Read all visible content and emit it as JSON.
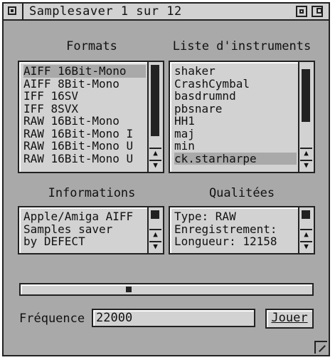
{
  "window": {
    "title": "Samplesaver 1 sur 12"
  },
  "formats": {
    "label": "Formats",
    "items": [
      "AIFF 16Bit-Mono",
      "AIFF 8Bit-Mono",
      "IFF 16SV",
      "IFF 8SVX",
      "RAW 16Bit-Mono",
      "RAW 16Bit-Mono I",
      "RAW 16Bit-Mono U",
      "RAW 16Bit-Mono U"
    ],
    "selected_index": 0
  },
  "instruments": {
    "label": "Liste d'instruments",
    "items": [
      "shaker",
      "CrashCymbal",
      "basdrumnd",
      "pbsnare",
      "HH1",
      "maj",
      "min",
      "ck.starharpe"
    ],
    "selected_index": 7
  },
  "informations": {
    "label": "Informations",
    "lines": [
      "Apple/Amiga AIFF",
      "Samples saver",
      "by DEFECT"
    ]
  },
  "qualites": {
    "label": "Qualitées",
    "lines": [
      "Type: RAW",
      "Enregistrement:",
      "Longueur: 12158"
    ]
  },
  "frequency": {
    "label": "Fréquence",
    "value": "22000"
  },
  "play_button": {
    "label": "Jouer"
  },
  "icons": {
    "close": "close-icon",
    "iconify": "iconify-icon",
    "backdrop": "backdrop-icon",
    "resize": "resize-icon"
  }
}
